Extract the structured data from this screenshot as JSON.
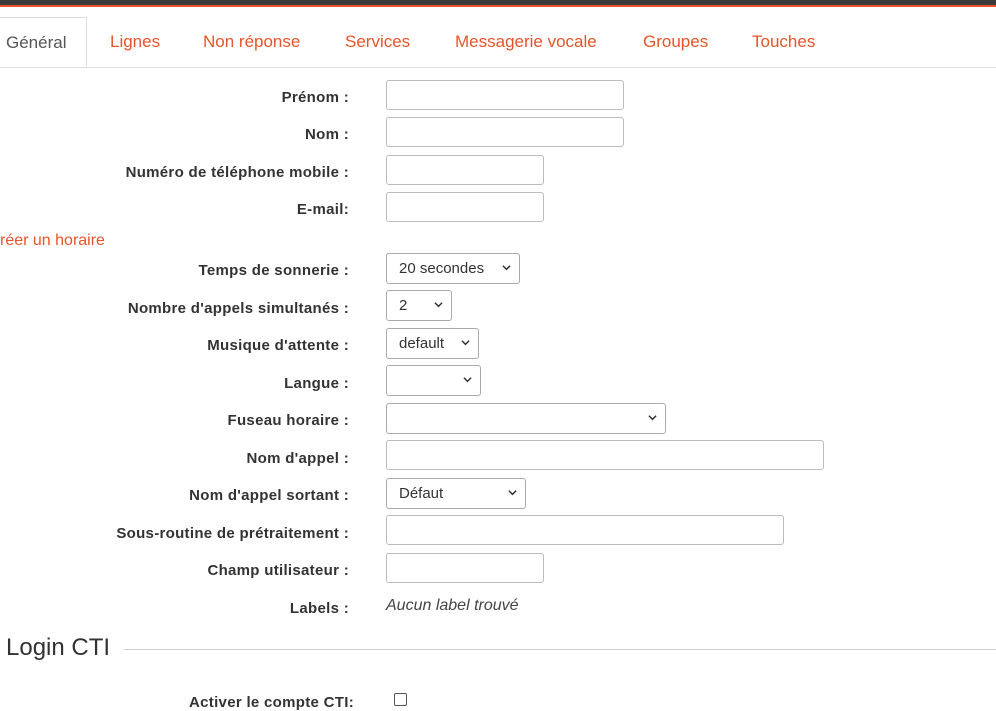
{
  "tabs": [
    {
      "label": "Général",
      "active": true
    },
    {
      "label": "Lignes"
    },
    {
      "label": "Non réponse"
    },
    {
      "label": "Services"
    },
    {
      "label": "Messagerie vocale"
    },
    {
      "label": "Groupes"
    },
    {
      "label": "Touches"
    }
  ],
  "form": {
    "prenom": {
      "label": "Prénom :",
      "value": ""
    },
    "nom": {
      "label": "Nom :",
      "value": ""
    },
    "mobile": {
      "label": "Numéro de téléphone mobile :",
      "value": ""
    },
    "email": {
      "label": "E-mail:",
      "value": ""
    },
    "create_schedule_link": "réer un horaire",
    "ring_time": {
      "label": "Temps de sonnerie :",
      "value": "20 secondes"
    },
    "simultaneous_calls": {
      "label": "Nombre d'appels simultanés :",
      "value": "2"
    },
    "music_on_hold": {
      "label": "Musique d'attente :",
      "value": "default"
    },
    "language": {
      "label": "Langue :",
      "value": ""
    },
    "timezone": {
      "label": "Fuseau horaire :",
      "value": ""
    },
    "caller_id": {
      "label": "Nom d'appel :",
      "value": ""
    },
    "outgoing_caller_id": {
      "label": "Nom d'appel sortant :",
      "value": "Défaut"
    },
    "preprocess_subroutine": {
      "label": "Sous-routine de prétraitement :",
      "value": ""
    },
    "user_field": {
      "label": "Champ utilisateur :",
      "value": ""
    },
    "labels": {
      "label": "Labels :",
      "value": "Aucun label trouvé"
    }
  },
  "cti": {
    "section_title": "Login CTI",
    "enable_label": "Activer le compte CTI:",
    "enabled": false
  },
  "colors": {
    "accent": "#e8542a",
    "dark_bar": "#3a3a3a"
  },
  "icons": {
    "select_arrow": "chevron-down-icon"
  }
}
